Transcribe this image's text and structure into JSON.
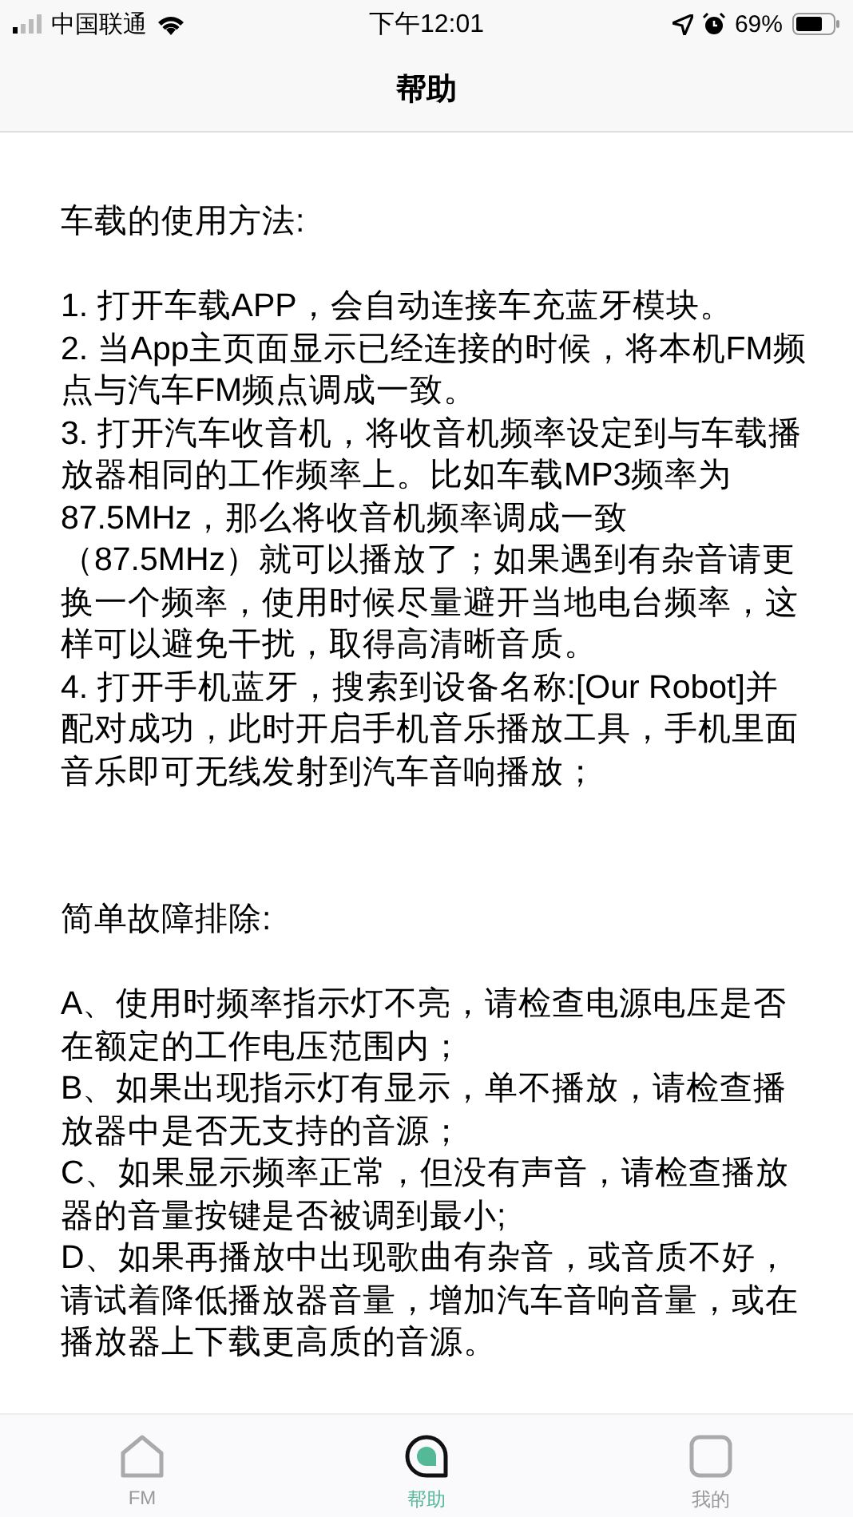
{
  "status_bar": {
    "carrier": "中国联通",
    "time": "下午12:01",
    "battery": "69%"
  },
  "nav_bar": {
    "title": "帮助"
  },
  "sections": [
    {
      "title": "车载的使用方法:",
      "items": [
        "1. 打开车载APP，会自动连接车充蓝牙模块。",
        "2. 当App主页面显示已经连接的时候，将本机FM频点与汽车FM频点调成一致。",
        "3. 打开汽车收音机，将收音机频率设定到与车载播放器相同的工作频率上。比如车载MP3频率为87.5MHz，那么将收音机频率调成一致（87.5MHz）就可以播放了；如果遇到有杂音请更换一个频率，使用时候尽量避开当地电台频率，这样可以避免干扰，取得高清晰音质。",
        "4. 打开手机蓝牙，搜索到设备名称:[Our Robot]并配对成功，此时开启手机音乐播放工具，手机里面音乐即可无线发射到汽车音响播放；"
      ]
    },
    {
      "title": "简单故障排除:",
      "items": [
        "A、使用时频率指示灯不亮，请检查电源电压是否在额定的工作电压范围内；",
        "B、如果出现指示灯有显示，单不播放，请检查播放器中是否无支持的音源；",
        "C、如果显示频率正常，但没有声音，请检查播放器的音量按键是否被调到最小;",
        "D、如果再播放中出现歌曲有杂音，或音质不好，请试着降低播放器音量，增加汽车音响音量，或在播放器上下载更高质的音源。"
      ]
    }
  ],
  "tab_bar": [
    {
      "label": "FM",
      "kind": "home",
      "selected": false
    },
    {
      "label": "帮助",
      "kind": "help",
      "selected": true
    },
    {
      "label": "我的",
      "kind": "me",
      "selected": false
    }
  ]
}
